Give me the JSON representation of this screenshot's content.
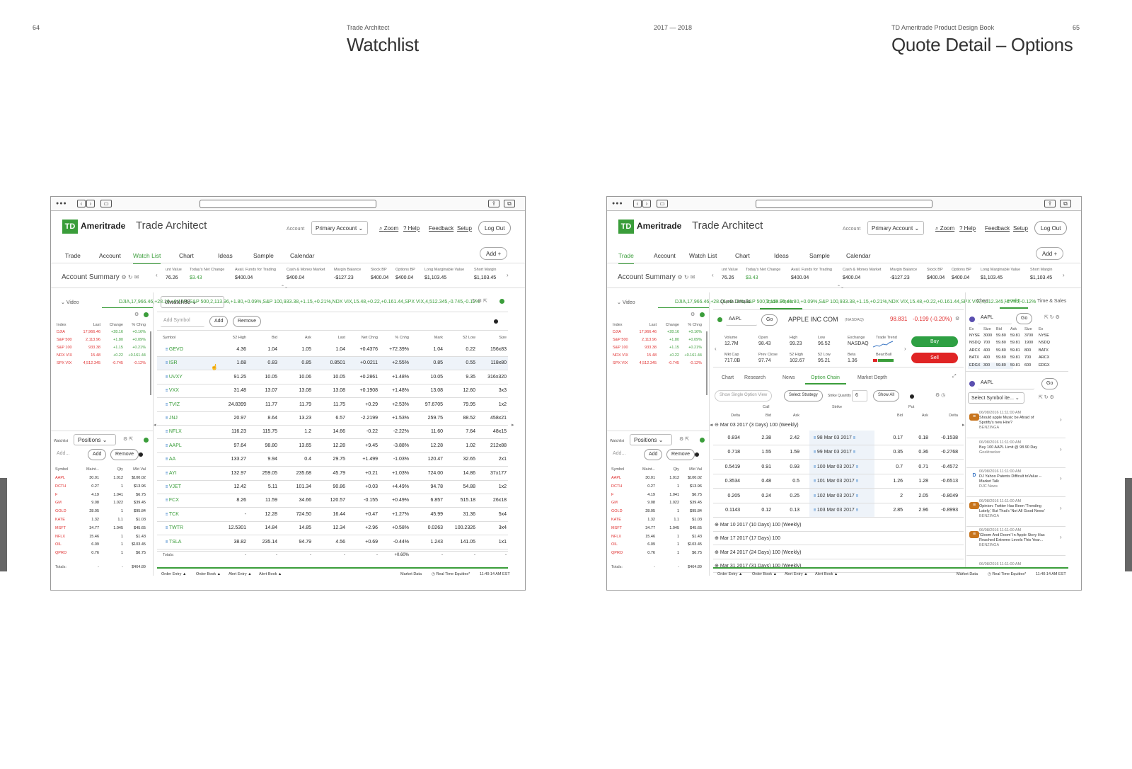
{
  "spread": {
    "left_page": "64",
    "right_page": "65",
    "left_book": "Trade Architect",
    "center_book": "2017 — 2018",
    "right_book": "TD Ameritrade Product Design Book",
    "left_title": "Watchlist",
    "right_title": "Quote Detail – Options"
  },
  "app": {
    "logo": "TD",
    "brand": "Ameritrade",
    "product": "Trade Architect",
    "account_label": "Account",
    "account_value": "Primary Account",
    "zoom": "Zoom",
    "help": "Help",
    "feedback": "Feedback",
    "setup": "Setup",
    "logout": "Log Out",
    "add": "Add"
  },
  "nav": [
    "Trade",
    "Account",
    "Watch List",
    "Chart",
    "Ideas",
    "Sample",
    "Calendar"
  ],
  "summary": {
    "title": "Account Summary",
    "labels": [
      "unt Value",
      "Today's Net Change",
      "Avail. Funds for Trading",
      "Cash & Money Market",
      "Margin Balance",
      "Stock BP",
      "Options BP",
      "Long Marginable Value",
      "Short Margin"
    ],
    "values": [
      "76.26",
      "$3.43",
      "$400.04",
      "$400.04",
      "-$127.23",
      "$400.04",
      "$400.04",
      "$1,103.45",
      "$1,103.45"
    ]
  },
  "left_panel": {
    "video": "Video",
    "indices": [
      [
        "DJIA",
        "17,966.46",
        "+28.16",
        "+0.16%"
      ],
      [
        "S&P 500",
        "2,113.96",
        "+1.80",
        "+0.09%"
      ],
      [
        "S&P 100",
        "933.38",
        "+1.15",
        "+0.21%"
      ],
      [
        "NDX VIX",
        "15.48",
        "+0.22",
        "+0.161.44"
      ],
      [
        "SPX VIX",
        "4,512.345",
        "-0.745",
        "-0.12%"
      ]
    ],
    "idx_headers": [
      "Index",
      "Last",
      "Change",
      "% Chng"
    ],
    "watchlist_label": "Watchlist",
    "positions": "Positions",
    "add_placeholder": "Add...",
    "add": "Add",
    "remove": "Remove",
    "pos_headers": [
      "Symbol",
      "Maint...",
      "Qty",
      "Mkt Val"
    ],
    "positions_rows": [
      [
        "AAPL",
        "30.01",
        "1.012",
        "$100.02"
      ],
      [
        "DCTH",
        "0.27",
        "1",
        "$13.96"
      ],
      [
        "F",
        "4.19",
        "1.041",
        "$6.75"
      ],
      [
        "GM",
        "9.08",
        "1.022",
        "$39.45"
      ],
      [
        "GOLD",
        "28.05",
        "1",
        "$95.84"
      ],
      [
        "KATE",
        "1.32",
        "1.1",
        "$1.03"
      ],
      [
        "MSFT",
        "34.77",
        "1.045",
        "$45.65"
      ],
      [
        "NFLX",
        "15.46",
        "1",
        "$1.43"
      ],
      [
        "OIL",
        "6.09",
        "1",
        "$103.45"
      ],
      [
        "QPRO",
        "0.76",
        "1",
        "$6.75"
      ]
    ],
    "totals_label": "Totals:",
    "totals": [
      "-",
      "-",
      "$464.89"
    ]
  },
  "watchlist": {
    "name": "ctwatch88",
    "add_symbol": "Add Symbol",
    "add": "Add",
    "remove": "Remove",
    "headers": [
      "Symbol",
      "52 High",
      "Bid",
      "Ask",
      "Last",
      "Net Chng",
      "% Cnhg",
      "Mark",
      "52 Low",
      "Size"
    ],
    "rows": [
      [
        "GEVO",
        "4.36",
        "1.04",
        "1.05",
        "1.04",
        "+0.4376",
        "+72.39%",
        "1.04",
        "0.22",
        "156x83"
      ],
      [
        "ISR",
        "1.68",
        "0.83",
        "0.85",
        "0.8501",
        "+0.0211",
        "+2.55%",
        "0.85",
        "0.55",
        "118x80"
      ],
      [
        "UVXY",
        "91.25",
        "10.05",
        "10.06",
        "10.05",
        "+0.2861",
        "+1.48%",
        "10.05",
        "9.35",
        "316x320"
      ],
      [
        "VXX",
        "31.48",
        "13.07",
        "13.08",
        "13.08",
        "+0.1908",
        "+1.48%",
        "13.08",
        "12.60",
        "3x3"
      ],
      [
        "TVIZ",
        "24.8399",
        "11.77",
        "11.79",
        "11.75",
        "+0.29",
        "+2.53%",
        "97.6705",
        "79.95",
        "1x2"
      ],
      [
        "JNJ",
        "20.97",
        "8.64",
        "13.23",
        "6.57",
        "-2.2199",
        "+1.53%",
        "259.75",
        "88.52",
        "458x21"
      ],
      [
        "NFLX",
        "116.23",
        "115.75",
        "1.2",
        "14.66",
        "-0.22",
        "-2.22%",
        "11.60",
        "7.64",
        "48x15"
      ],
      [
        "AAPL",
        "97.64",
        "98.80",
        "13.65",
        "12.28",
        "+9.45",
        "-3.88%",
        "12.28",
        "1.02",
        "212x88"
      ],
      [
        "AA",
        "133.27",
        "9.94",
        "0.4",
        "29.75",
        "+1.499",
        "-1.03%",
        "120.47",
        "32.65",
        "2x1"
      ],
      [
        "AYI",
        "132.97",
        "259.05",
        "235.68",
        "45.79",
        "+0.21",
        "+1.03%",
        "724.00",
        "14.86",
        "37x177"
      ],
      [
        "VJET",
        "12.42",
        "5.11",
        "101.34",
        "90.86",
        "+0.03",
        "+4.49%",
        "94.78",
        "54.88",
        "1x2"
      ],
      [
        "FCX",
        "8.26",
        "11.59",
        "34.66",
        "120.57",
        "-0.155",
        "+0.49%",
        "6.857",
        "515.18",
        "26x18"
      ],
      [
        "TCK",
        "-",
        "12.28",
        "724.50",
        "16.44",
        "+0.47",
        "+1.27%",
        "45.99",
        "31.36",
        "5x4"
      ],
      [
        "TWTR",
        "12.5301",
        "14.84",
        "14.85",
        "12.34",
        "+2.96",
        "+0.58%",
        "0.0263",
        "100.2326",
        "3x4"
      ],
      [
        "TSLA",
        "38.82",
        "235.14",
        "94.79",
        "4.56",
        "+0.69",
        "-0.44%",
        "1.243",
        "141.05",
        "1x1"
      ]
    ],
    "totals_label": "Totals:",
    "totals": [
      "-",
      "-",
      "-",
      "-",
      "-",
      "+0.60%",
      "-",
      "-",
      "-"
    ]
  },
  "footer": {
    "order_entry": "Order Entry ▲",
    "order_book": "Order Book ▲",
    "alert_entry": "Alert Entry ▲",
    "alert_book": "Alert Book ▲",
    "market_data": "Market Data",
    "realtime": "Real Time Equities*",
    "time": "11:40:14 AM EST"
  },
  "quote": {
    "tabs": [
      "Quote Details",
      "Trade Finder"
    ],
    "symbol": "AAPL",
    "go": "Go",
    "name": "APPLE INC COM",
    "exchange_tag": "(NASDAQ)",
    "price": "98.831",
    "change": "-0.199 (-0.20%)",
    "fields": [
      [
        "Volume",
        "12.7M"
      ],
      [
        "Open",
        "98.43"
      ],
      [
        "High",
        "99.23"
      ],
      [
        "Low",
        "96.52"
      ],
      [
        "Exchange",
        "NASDAQ"
      ],
      [
        "Trade Trend",
        ""
      ],
      [
        "Mkt Cap",
        "717.0B"
      ],
      [
        "Prev Close",
        "97.74"
      ],
      [
        "52 High",
        "102.67"
      ],
      [
        "52 Low",
        "95.21"
      ],
      [
        "Beta",
        "1.36"
      ],
      [
        "Bear:Bull",
        ""
      ]
    ],
    "buy": "Buy",
    "sell": "Sell",
    "subtabs": [
      "Chart",
      "Research",
      "News",
      "Option Chain",
      "Market Depth"
    ],
    "show_single": "Show Single Option View",
    "select_strategy": "Select Strategy",
    "strike_qty_label": "Strike Quantity",
    "strike_qty": "6",
    "show_all": "Show All",
    "chain_groups": [
      "Call",
      "Strike",
      "Put"
    ],
    "chain_headers": [
      "Delta",
      "Bid",
      "Ask",
      "",
      "Bid",
      "Ask",
      "Delta"
    ],
    "expiry_open": "Mar 03 2017 (3 Days) 100 (Weekly)",
    "chain": [
      [
        "0.834",
        "2.38",
        "2.42",
        "98 Mar 03 2017",
        "0.17",
        "0.18",
        "-0.1538"
      ],
      [
        "0.718",
        "1.55",
        "1.59",
        "99 Mar 03 2017",
        "0.35",
        "0.36",
        "-0.2768"
      ],
      [
        "0.5419",
        "0.91",
        "0.93",
        "100 Mar 03 2017",
        "0.7",
        "0.71",
        "-0.4572"
      ],
      [
        "0.3534",
        "0.48",
        "0.5",
        "101 Mar 03 2017",
        "1.26",
        "1.28",
        "-0.6513"
      ],
      [
        "0.205",
        "0.24",
        "0.25",
        "102 Mar 03 2017",
        "2",
        "2.05",
        "-0.8049"
      ],
      [
        "0.1143",
        "0.12",
        "0.13",
        "103 Mar 03 2017",
        "2.85",
        "2.96",
        "-0.8993"
      ]
    ],
    "expiries": [
      "Mar 10 2017 (10 Days) 100 (Weekly)",
      "Mar 17 2017 (17 Days) 100",
      "Mar 24 2017 (24 Days) 100 (Weekly)",
      "Mar 31 2017 (31 Days) 100 (Weekly)"
    ]
  },
  "level2": {
    "tabs": [
      "Chart",
      "Level II",
      "Time & Sales"
    ],
    "symbol": "AAPL",
    "go": "Go",
    "headers": [
      "Ex",
      "Size",
      "Bid",
      "Ask",
      "Size",
      "Ex"
    ],
    "rows": [
      [
        "NYSE",
        "3000",
        "59.80",
        "59.81",
        "3700",
        "NYSE"
      ],
      [
        "NSDQ",
        "700",
        "59.80",
        "59.81",
        "1900",
        "NSDQ"
      ],
      [
        "ARCX",
        "400",
        "59.80",
        "59.81",
        "800",
        "BATX"
      ],
      [
        "BATX",
        "400",
        "59.80",
        "59.81",
        "700",
        "ARCX"
      ],
      [
        "EDGX",
        "300",
        "59.80",
        "59.81",
        "600",
        "EDGX"
      ]
    ]
  },
  "news": {
    "symbol": "AAPL",
    "go": "Go",
    "select": "Select Symbol ite...",
    "items": [
      [
        "06/08/2016 11:11:00 AM",
        "Should apple Music be Afraid of",
        "Spotify's new Hire?",
        "BENZINGA"
      ],
      [
        "06/08/2016 11:11:00 AM",
        "Buy 100 AAPL Limit @ 98.90 Day",
        "",
        "Geektracker"
      ],
      [
        "06/08/2016 11:11:00 AM",
        "DJ Yahoo Patents Difficult toValue --",
        "Market Talk",
        "DJC News"
      ],
      [
        "06/08/2016 11:11:00 AM",
        "Opinion: Twitter Has Been 'Trending",
        "Lately,' But That's 'Not All Good News'",
        "BENZINGA"
      ],
      [
        "06/08/2016 11:11:00 AM",
        "'Gloom And Doom' In Apple Story Has",
        "Reached Extreme Levels This Year...",
        "BENZINGA"
      ]
    ],
    "last_time": "06/08/2016 11:11:00 AM"
  }
}
